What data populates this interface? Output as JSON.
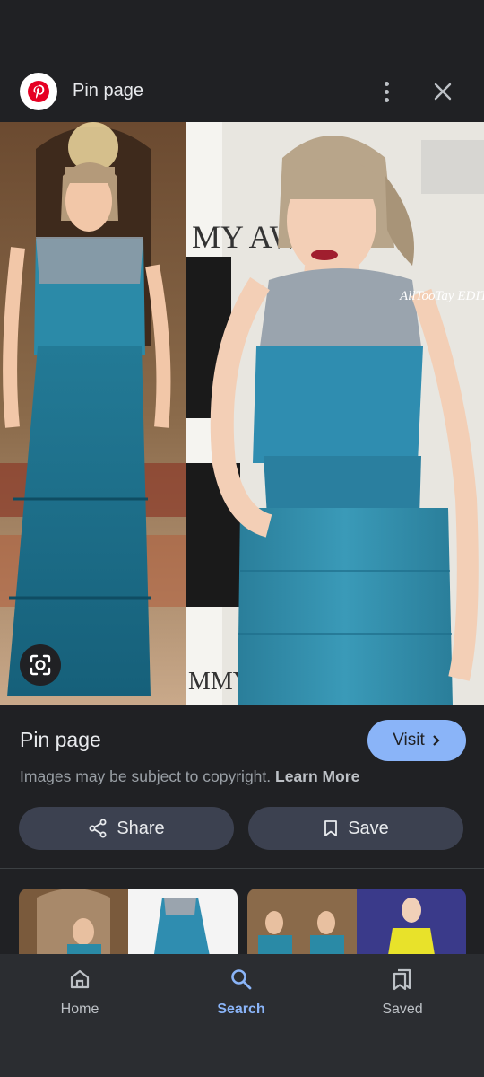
{
  "header": {
    "title": "Pin page",
    "logo_icon": "pinterest-logo",
    "more_icon": "more-vert-icon",
    "close_icon": "close-icon"
  },
  "image": {
    "watermark": "AllTooTay EDITS",
    "backdrop_left": "MY AW",
    "backdrop_bottom": "MMY"
  },
  "result": {
    "title": "Pin page",
    "visit_label": "Visit",
    "copyright_text": "Images may be subject to copyright.",
    "learn_more": "Learn More"
  },
  "actions": {
    "share_label": "Share",
    "save_label": "Save"
  },
  "nav": {
    "items": [
      {
        "label": "Home",
        "icon": "home-icon"
      },
      {
        "label": "Search",
        "icon": "search-icon",
        "active": true
      },
      {
        "label": "Saved",
        "icon": "saved-icon"
      }
    ]
  },
  "colors": {
    "background": "#202124",
    "accent": "#8ab4f8",
    "button_bg": "#3c4150",
    "pinterest_red": "#e60023",
    "dress_teal": "#2a8aa6"
  }
}
